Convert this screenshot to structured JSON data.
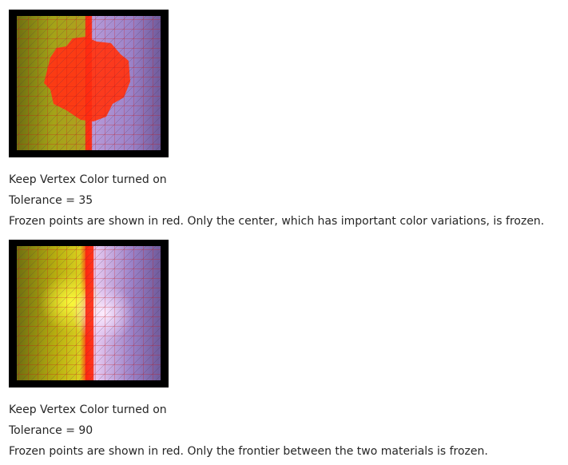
{
  "sections": [
    {
      "image": "vertex-color-mesh-tolerance-35",
      "lines": [
        "Keep Vertex Color turned on",
        "Tolerance = 35",
        "Frozen points are shown in red. Only the center, which has important color variations, is frozen."
      ]
    },
    {
      "image": "vertex-color-mesh-tolerance-90",
      "lines": [
        "Keep Vertex Color turned on",
        "Tolerance = 90",
        "Frozen points are shown in red. Only the frontier between the two materials is frozen."
      ]
    }
  ],
  "colors": {
    "frozen": "#ff2a1a",
    "material_left": "#a8a800",
    "material_right": "#9a7ec8",
    "background": "#000000"
  }
}
